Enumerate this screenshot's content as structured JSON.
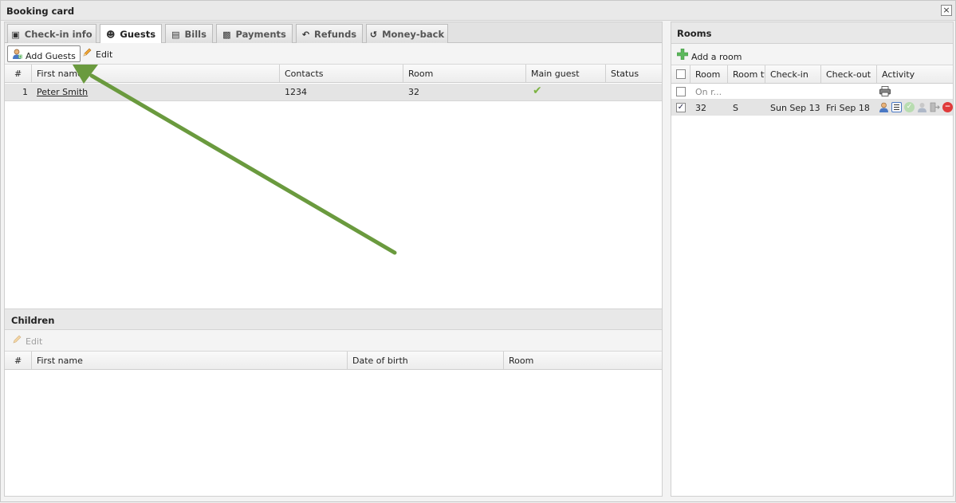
{
  "window": {
    "title": "Booking card",
    "close_icon": "×"
  },
  "tabs": [
    {
      "label": "Check-in info",
      "icon": "briefcase-icon"
    },
    {
      "label": "Guests",
      "icon": "users-icon"
    },
    {
      "label": "Bills",
      "icon": "document-icon"
    },
    {
      "label": "Payments",
      "icon": "money-icon"
    },
    {
      "label": "Refunds",
      "icon": "reply-icon"
    },
    {
      "label": "Money-back",
      "icon": "undo-icon"
    }
  ],
  "guests": {
    "toolbar": {
      "add_label": "Add Guests",
      "edit_label": "Edit"
    },
    "columns": [
      "#",
      "First name",
      "Contacts",
      "Room",
      "Main guest",
      "Status"
    ],
    "rows": [
      {
        "num": "1",
        "first_name": "Peter Smith",
        "contacts": "1234",
        "room": "32",
        "main_guest": "✔",
        "status": ""
      }
    ]
  },
  "children": {
    "title": "Children",
    "toolbar": {
      "edit_label": "Edit"
    },
    "columns": [
      "#",
      "First name",
      "Date of birth",
      "Room"
    ]
  },
  "rooms": {
    "title": "Rooms",
    "toolbar": {
      "add_label": "Add a room"
    },
    "columns": [
      "",
      "Room",
      "Room ty",
      "Check-in",
      "Check-out",
      "Activity"
    ],
    "rows": [
      {
        "checked": "",
        "room": "On r...",
        "room_type": "",
        "check_in": "",
        "check_out": ""
      },
      {
        "checked": "✓",
        "room": "32",
        "room_type": "S",
        "check_in": "Sun Sep 13",
        "check_out": "Fri Sep 18"
      }
    ]
  },
  "colors": {
    "arrow": "#6a9a3e",
    "checkmark": "#7cb342",
    "add_green": "#4caf50"
  }
}
